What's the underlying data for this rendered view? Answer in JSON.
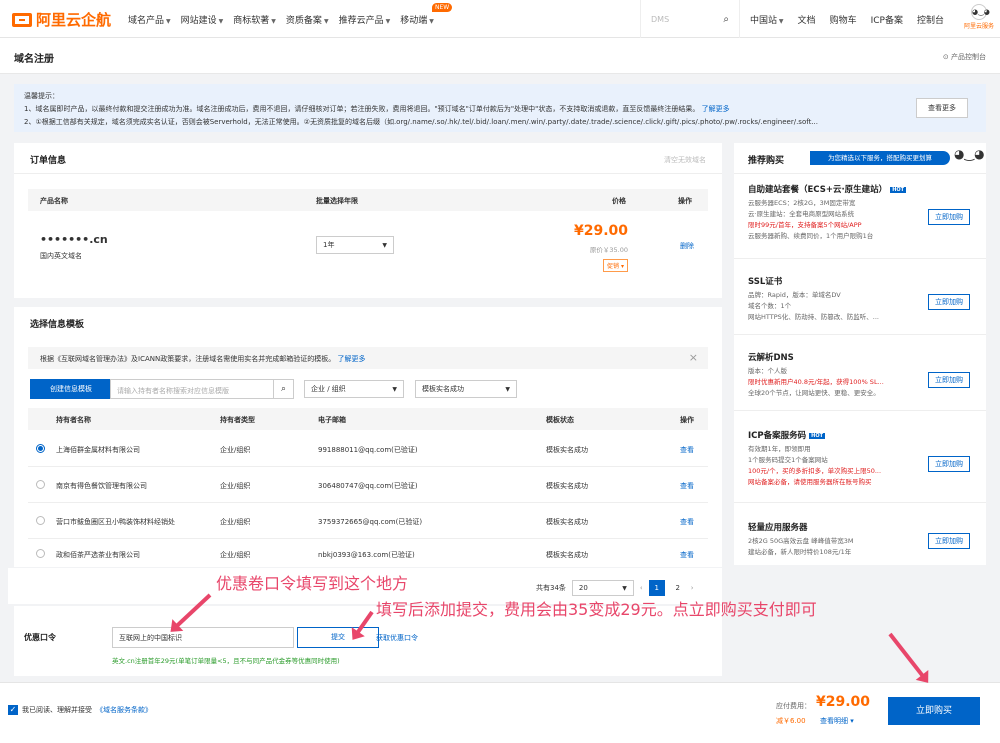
{
  "brand": {
    "name": "阿里云企航",
    "accent": "#ff6a00",
    "link": "#0064c8"
  },
  "nav": {
    "items": [
      "域名产品",
      "网站建设",
      "商标软著",
      "资质备案",
      "推荐云产品",
      "移动端"
    ],
    "new_badge": "NEW",
    "search_placeholder": "DMS",
    "right": [
      "中国站",
      "文档",
      "购物车",
      "ICP备案",
      "控制台"
    ],
    "avatar_label": "阿里云服务"
  },
  "page": {
    "title": "域名注册",
    "console_link": "产品控制台"
  },
  "notice": {
    "heading": "温馨提示：",
    "line1": "1、域名属即时产品，以最终付款和提交注册成功为准。域名注册成功后，费用不退回，请仔细核对订单；若注册失败，费用将退回。\"预订域名\"订单付款后为\"处理中\"状态，不支持取消或退款，直至反馈最终注册结果。",
    "line1_link": "了解更多",
    "line2": "2、①根据工信部有关规定，域名须完成实名认证，否则会被Serverhold，无法正常使用。②无资质批复的域名后缀（如.org/.name/.so/.hk/.tel/.bid/.loan/.men/.win/.party/.date/.trade/.science/.click/.gift/.pics/.photo/.pw/.rocks/.engineer/.soft...",
    "more_button": "查看更多"
  },
  "order": {
    "title": "订单信息",
    "clear": "清空无效域名",
    "columns": [
      "产品名称",
      "批量选择年限",
      "价格",
      "操作"
    ],
    "row": {
      "domain": "•••••••.cn",
      "type": "国内英文域名",
      "years": "1年",
      "price": "¥29.00",
      "orig_price": "原价￥35.00",
      "promo": "促销",
      "action": "删除"
    }
  },
  "template": {
    "title": "选择信息模板",
    "info": "根据《互联网域名管理办法》及ICANN政策要求，注册域名需使用实名并完成邮箱验证的模板。",
    "info_link": "了解更多",
    "create_button": "创建信息模板",
    "search_placeholder": "请输入持有者名称搜索对应信息模版",
    "filter_type": "企业 / 组织",
    "filter_status": "模板实名成功",
    "columns": [
      "持有者名称",
      "持有者类型",
      "电子邮箱",
      "模板状态",
      "操作"
    ],
    "rows": [
      {
        "name": "上海佰群金属材料有限公司",
        "type": "企业/组织",
        "email": "991888011@qq.com(已验证)",
        "status": "模板实名成功",
        "action": "查看"
      },
      {
        "name": "南京有得色餐饮管理有限公司",
        "type": "企业/组织",
        "email": "306480747@qq.com(已验证)",
        "status": "模板实名成功",
        "action": "查看"
      },
      {
        "name": "营口市鲅鱼圈区丑小鸭装饰材料经销处",
        "type": "企业/组织",
        "email": "3759372665@qq.com(已验证)",
        "status": "模板实名成功",
        "action": "查看"
      },
      {
        "name": "政和佰茶严选茶业有限公司",
        "type": "企业/组织",
        "email": "nbkj0393@163.com(已验证)",
        "status": "模板实名成功",
        "action": "查看"
      }
    ],
    "pagination": {
      "total": "共有34条",
      "page_size": "20",
      "pages": [
        "1",
        "2"
      ],
      "current": "1"
    }
  },
  "coupon": {
    "label": "优惠口令",
    "value": "互联网上的中国标识",
    "submit": "提交",
    "get_link": "获取优惠口令",
    "hint": "英文.cn注册首年29元(单笔订单限量<5，且不与同产品代金券等优惠同时使用)"
  },
  "bottom": {
    "agree": "我已阅读、理解并接受",
    "terms": "《域名服务条款》",
    "payable_label": "应付费用：",
    "payable": "¥29.00",
    "saved": "减￥6.00",
    "detail": "查看明细",
    "buy_button": "立即购买"
  },
  "sidebar": {
    "title": "推荐购买",
    "banner": "为您精选以下服务，搭配购买更划算",
    "buy_label": "立即加购",
    "items": [
      {
        "name": "自助建站套餐（ECS+云·原生建站）",
        "hot": "HOT",
        "lines": [
          "云服务器ECS：2核2G，3M固定带宽",
          "云·原生建站：全套电商原型网站系统",
          "限时99元/首年，支持备案5个网站/APP",
          "云服务器新购、续费同价，1个用户限购1台"
        ]
      },
      {
        "name": "SSL证书",
        "lines": [
          "品牌：Rapid，版本：单域名DV",
          "域名个数：1个",
          "网站HTTPS化、防劫持、防篡改、防监听、..."
        ]
      },
      {
        "name": "云解析DNS",
        "lines": [
          "版本：个人版",
          "限时优惠新用户40.8元/年起，获得100% SL...",
          "全球20个节点，让网站更快、更稳、更安全。"
        ]
      },
      {
        "name": "ICP备案服务码",
        "hot": "HOT",
        "lines": [
          "有效期1年，即领即用",
          "1个服务码提交1个备案网站",
          "100元/个，买的多折扣多，单次购买上限50...",
          "网站备案必备，请使用服务器所在账号购买"
        ]
      },
      {
        "name": "轻量应用服务器",
        "lines": [
          "2核2G 50G高效云盘 峰峰值带宽3M",
          "建站必备，新人限时特价108元/1年"
        ]
      }
    ]
  },
  "annotations": {
    "a1": "优惠卷口令填写到这个地方",
    "a2": "填写后添加提交，费用会由35变成29元。点立即购买支付即可",
    "color": "#e8466a"
  }
}
